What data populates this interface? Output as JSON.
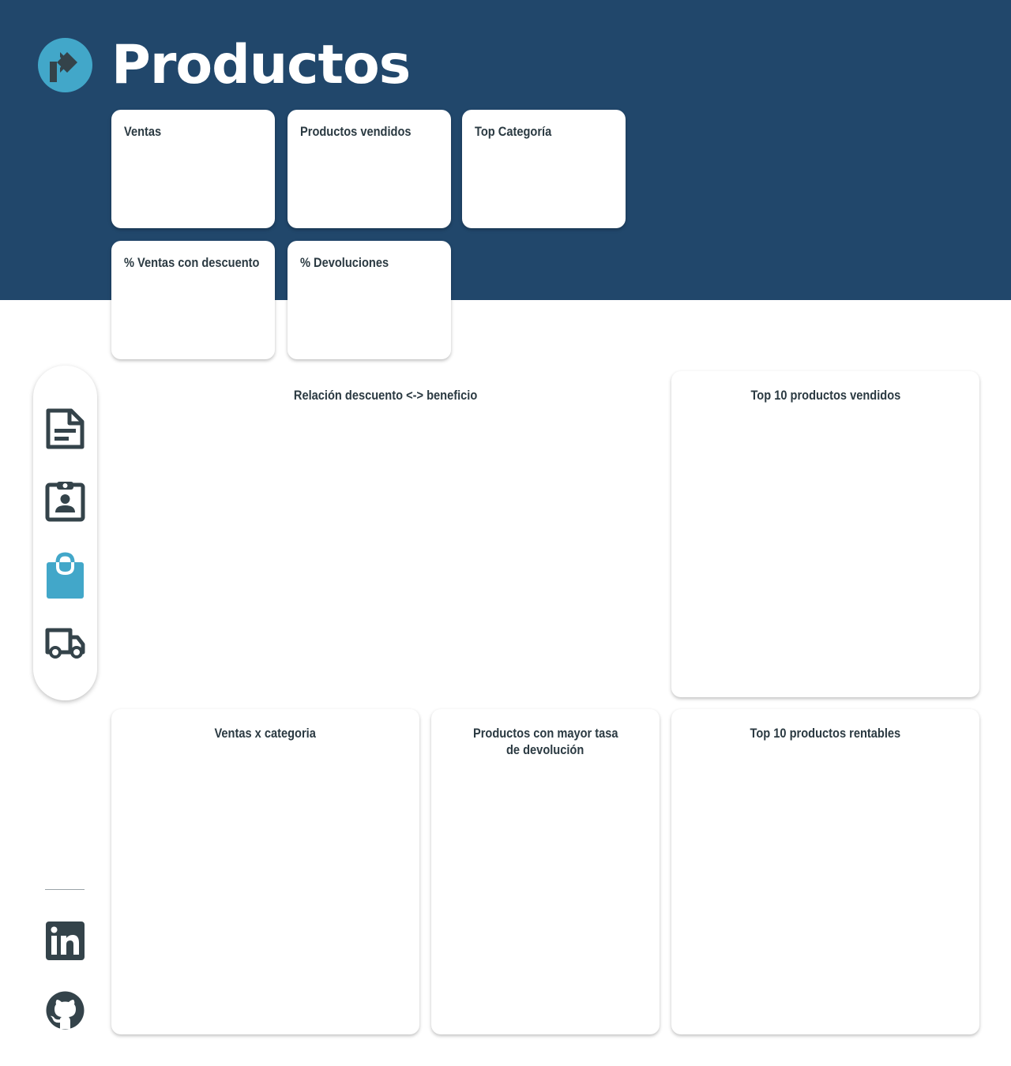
{
  "header": {
    "title": "Productos"
  },
  "kpis": [
    {
      "label": "Ventas"
    },
    {
      "label": "Productos vendidos"
    },
    {
      "label": "Top Categoría"
    },
    {
      "label": "% Ventas con descuento"
    },
    {
      "label": "% Devoluciones"
    }
  ],
  "panels": {
    "discount_profit": "Relación descuento <-> beneficio",
    "top10_sold": "Top 10 productos vendidos",
    "sales_by_category": "Ventas x categoria",
    "return_rate_line1": "Productos con mayor tasa",
    "return_rate_line2": "de devolución",
    "top10_profitable": "Top 10 productos rentables"
  },
  "sidebar": {
    "items": [
      {
        "icon": "document-icon",
        "active": false
      },
      {
        "icon": "clipboard-user-icon",
        "active": false
      },
      {
        "icon": "shopping-bag-icon",
        "active": true
      },
      {
        "icon": "truck-icon",
        "active": false
      }
    ],
    "social": [
      {
        "icon": "linkedin-icon"
      },
      {
        "icon": "github-icon"
      }
    ]
  },
  "colors": {
    "header_bg": "#21476b",
    "accent": "#42a7c9",
    "icon": "#34434a"
  }
}
